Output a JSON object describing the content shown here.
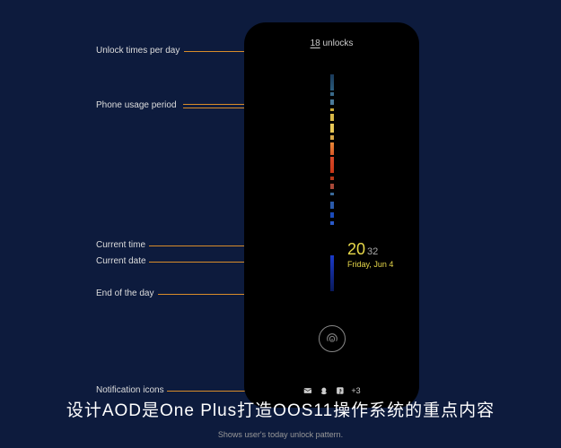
{
  "callouts": {
    "unlock_times": "Unlock times per day",
    "usage_period": "Phone usage period",
    "current_time": "Current time",
    "current_date": "Current date",
    "end_of_day": "End of the day",
    "notif_icons": "Notification icons"
  },
  "phone": {
    "unlock_number": "18",
    "unlock_label": "unlocks",
    "time_hour": "20",
    "time_minute": "32",
    "date": "Friday, Jun 4",
    "notif_more": "+3"
  },
  "headline": "设计AOD是One Plus打造OOS11操作系统的重点内容",
  "subtitle": "Shows user's today unlock pattern.",
  "colors": {
    "accent": "#d88c2a",
    "time": "#e8d94a"
  }
}
